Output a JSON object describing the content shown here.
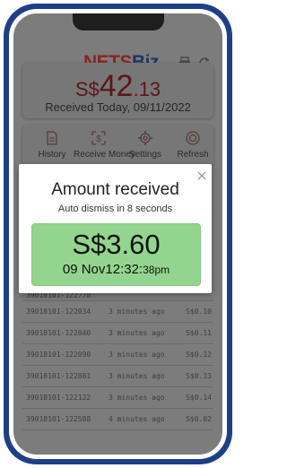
{
  "app": {
    "logo_part1": "NETS",
    "logo_part2": "Biz"
  },
  "summary": {
    "currency": "S$",
    "amount_int": "42",
    "amount_dec": ".13",
    "received_label": "Received Today, 09/11/2022"
  },
  "menu": [
    {
      "label": "History",
      "icon": "document-icon"
    },
    {
      "label": "Receive Money",
      "icon": "dollar-frame-icon"
    },
    {
      "label": "Settings",
      "icon": "gear-icon"
    },
    {
      "label": "Refresh",
      "icon": "refresh-circle-icon"
    }
  ],
  "toolbar": {
    "printer_icon": "printer-icon",
    "reload_icon": "reload-icon"
  },
  "transactions": [
    {
      "ref": "39018101-122034",
      "time": "3 minutes ago",
      "amount": "S$0.10"
    },
    {
      "ref": "39018101-122040",
      "time": "3 minutes ago",
      "amount": "S$0.11"
    },
    {
      "ref": "39018101-122090",
      "time": "3 minutes ago",
      "amount": "S$0.12"
    },
    {
      "ref": "39018101-122881",
      "time": "3 minutes ago",
      "amount": "S$0.13"
    },
    {
      "ref": "39018101-122122",
      "time": "3 minutes ago",
      "amount": "S$0.14"
    },
    {
      "ref": "39018101-122588",
      "time": "4 minutes ago",
      "amount": "S$0.02"
    }
  ],
  "partial_row": {
    "ref": "39018101-122778"
  },
  "dialog": {
    "title": "Amount received",
    "subtitle": "Auto dismiss in 8 seconds",
    "amount": "S$3.60",
    "date_main": "09 Nov12:32:",
    "date_sec": "38pm",
    "close_icon": "close-icon",
    "colors": {
      "highlight": "#93d58e",
      "frame": "#1d3f8a"
    }
  }
}
